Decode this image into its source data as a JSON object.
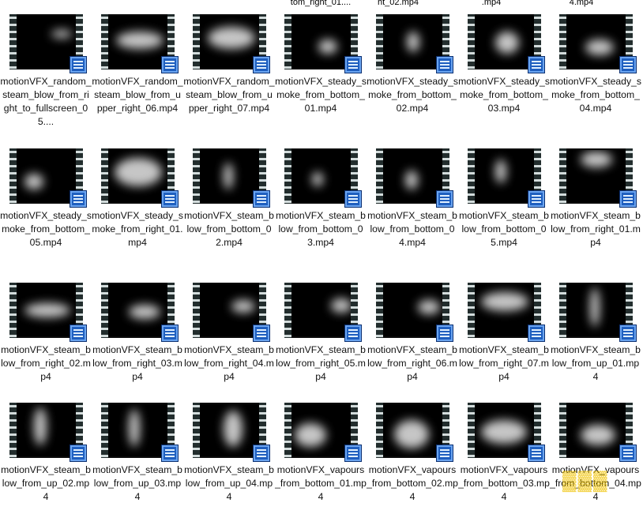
{
  "top_row_labels": [
    "tom_right_01....",
    "ht_02.mp4",
    ".mp4",
    "4.mp4"
  ],
  "files": [
    {
      "name": "motionVFX_random_steam_blow_from_right_to_fullscreen_05...."
    },
    {
      "name": "motionVFX_random_steam_blow_from_upper_right_06.mp4"
    },
    {
      "name": "motionVFX_random_steam_blow_from_upper_right_07.mp4"
    },
    {
      "name": "motionVFX_steady_smoke_from_bottom_01.mp4"
    },
    {
      "name": "motionVFX_steady_smoke_from_bottom_02.mp4"
    },
    {
      "name": "motionVFX_steady_smoke_from_bottom_03.mp4"
    },
    {
      "name": "motionVFX_steady_smoke_from_bottom_04.mp4"
    },
    {
      "name": "motionVFX_steady_smoke_from_bottom_05.mp4"
    },
    {
      "name": "motionVFX_steady_smoke_from_right_01.mp4"
    },
    {
      "name": "motionVFX_steam_blow_from_bottom_02.mp4"
    },
    {
      "name": "motionVFX_steam_blow_from_bottom_03.mp4"
    },
    {
      "name": "motionVFX_steam_blow_from_bottom_04.mp4"
    },
    {
      "name": "motionVFX_steam_blow_from_bottom_05.mp4"
    },
    {
      "name": "motionVFX_steam_blow_from_right_01.mp4"
    },
    {
      "name": "motionVFX_steam_blow_from_right_02.mp4"
    },
    {
      "name": "motionVFX_steam_blow_from_right_03.mp4"
    },
    {
      "name": "motionVFX_steam_blow_from_right_04.mp4"
    },
    {
      "name": "motionVFX_steam_blow_from_right_05.mp4"
    },
    {
      "name": "motionVFX_steam_blow_from_right_06.mp4"
    },
    {
      "name": "motionVFX_steam_blow_from_right_07.mp4"
    },
    {
      "name": "motionVFX_steam_blow_from_up_01.mp4"
    },
    {
      "name": "motionVFX_steam_blow_from_up_02.mp4"
    },
    {
      "name": "motionVFX_steam_blow_from_up_03.mp4"
    },
    {
      "name": "motionVFX_steam_blow_from_up_04.mp4"
    },
    {
      "name": "motionVFX_vapours_from_bottom_01.mp4"
    },
    {
      "name": "motionVFX_vapours_from_bottom_02.mp4"
    },
    {
      "name": "motionVFX_vapours_from_bottom_03.mp4"
    },
    {
      "name": "motionVFX_vapours_from_bottom_04.mp4"
    }
  ],
  "icons": {
    "file_type_badge": "video-file-badge-icon"
  }
}
